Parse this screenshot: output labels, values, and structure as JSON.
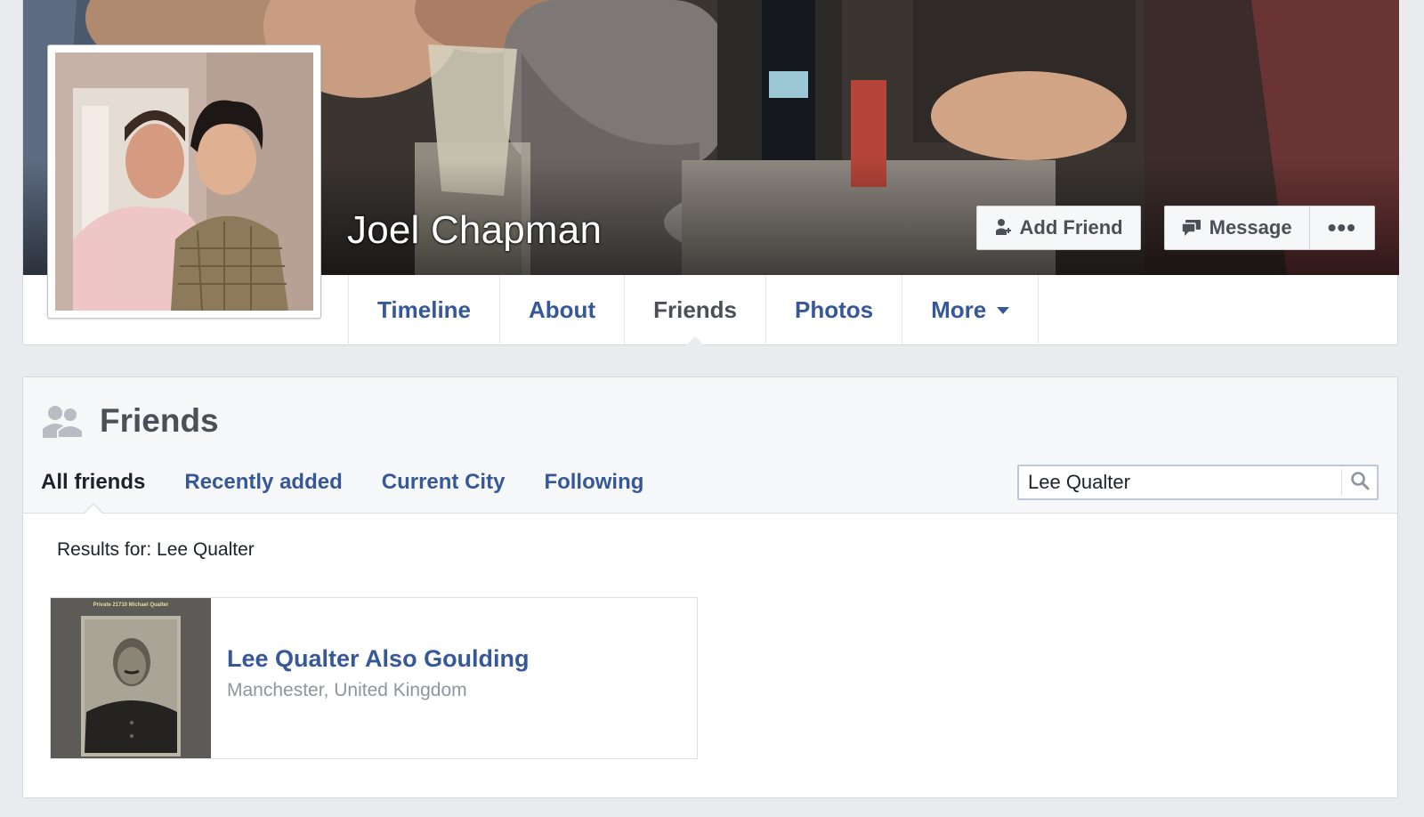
{
  "profile": {
    "name": "Joel Chapman",
    "actions": {
      "add_friend": "Add Friend",
      "message": "Message",
      "more": "•••"
    }
  },
  "tabs": [
    {
      "label": "Timeline"
    },
    {
      "label": "About"
    },
    {
      "label": "Friends",
      "active": true
    },
    {
      "label": "Photos"
    },
    {
      "label": "More",
      "has_caret": true
    }
  ],
  "friends": {
    "title": "Friends",
    "subtabs": [
      {
        "label": "All friends",
        "active": true
      },
      {
        "label": "Recently added"
      },
      {
        "label": "Current City"
      },
      {
        "label": "Following"
      }
    ],
    "search": {
      "value": "Lee Qualter"
    },
    "results_label": "Results for: Lee Qualter",
    "results": [
      {
        "name": "Lee Qualter Also Goulding",
        "location": "Manchester, United Kingdom",
        "photo_caption": "Private 21710 Michael Qualter"
      }
    ]
  },
  "colors": {
    "link": "#365899",
    "page_bg": "#e9ebee",
    "text_dark": "#4b4f56",
    "muted": "#90949c"
  },
  "icons": {
    "add_friend": "add-friend-icon",
    "message": "message-icon",
    "friends_section": "friends-icon",
    "search": "search-icon",
    "more_caret": "caret-down-icon"
  }
}
